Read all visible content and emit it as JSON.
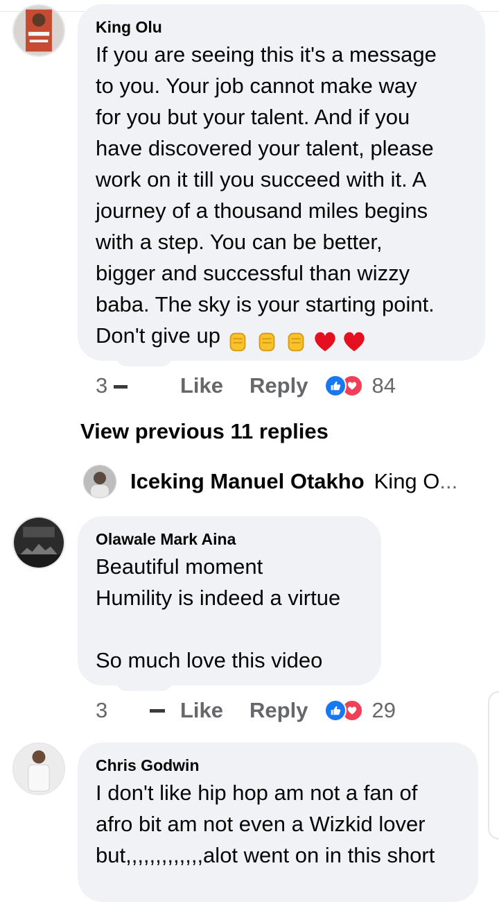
{
  "comments": [
    {
      "author": "King Olu",
      "text": "If you are seeing this it's a message\nto you. Your job cannot make way\nfor you but your talent. And if you\nhave discovered your talent, please\nwork on it till you succeed with it. A\njourney of a thousand miles begins\nwith a step. You can be better,\nbigger and successful than wizzy\nbaba. The sky is your starting point.\nDon't give up",
      "emojis": [
        "raised-fist-icon",
        "raised-fist-icon",
        "raised-fist-icon",
        "red-heart-icon",
        "red-heart-icon"
      ],
      "reply_count": "3",
      "like_label": "Like",
      "reply_label": "Reply",
      "reaction_count": "84"
    },
    {
      "author": "Olawale Mark Aina",
      "text": "Beautiful moment\nHumility is indeed a virtue\n\nSo much love this video",
      "reply_count": "3",
      "like_label": "Like",
      "reply_label": "Reply",
      "reaction_count": "29"
    },
    {
      "author": "Chris Godwin",
      "text": "I don't like hip hop am not a fan of\nafro bit am not even a Wizkid lover\nbut,,,,,,,,,,,,,alot went on in this short"
    }
  ],
  "view_previous": "View previous 11 replies",
  "reply_preview": {
    "name": "Iceking Manuel Otakho",
    "snippet": "King O",
    "ellipsis": "..."
  },
  "colors": {
    "bubble": "#f0f2f5",
    "secondary_text": "#65676b",
    "like_blue": "#1877f2",
    "love_red": "#f33e58"
  }
}
